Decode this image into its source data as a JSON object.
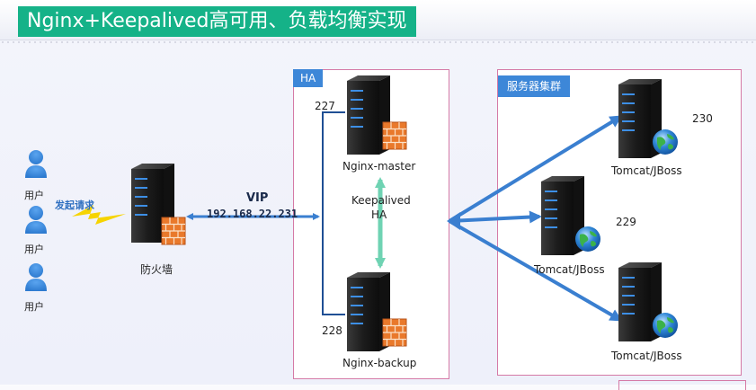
{
  "title": "Nginx+Keepalived高可用、负载均衡实现",
  "users": [
    "用户",
    "用户",
    "用户"
  ],
  "request_label": "发起请求",
  "firewall_label": "防火墙",
  "vip": {
    "label": "VIP",
    "address": "192.168.22.231"
  },
  "ha_box": {
    "label": "HA",
    "master": {
      "id": "227",
      "label": "Nginx-master"
    },
    "backup": {
      "id": "228",
      "label": "Nginx-backup"
    },
    "link_label": [
      "Keepalived",
      "HA"
    ]
  },
  "cluster": {
    "label": "服务器集群",
    "servers": [
      {
        "id": "230",
        "label": "Tomcat/JBoss"
      },
      {
        "id": "229",
        "label": "Tomcat/JBoss"
      },
      {
        "id": "",
        "label": "Tomcat/JBoss"
      }
    ]
  },
  "colors": {
    "accent": "#15b288",
    "blue": "#3d87d8",
    "box_border": "#d57aa6",
    "arrow": "#3a7fd0",
    "ha_arrow": "#6fd3b3"
  }
}
